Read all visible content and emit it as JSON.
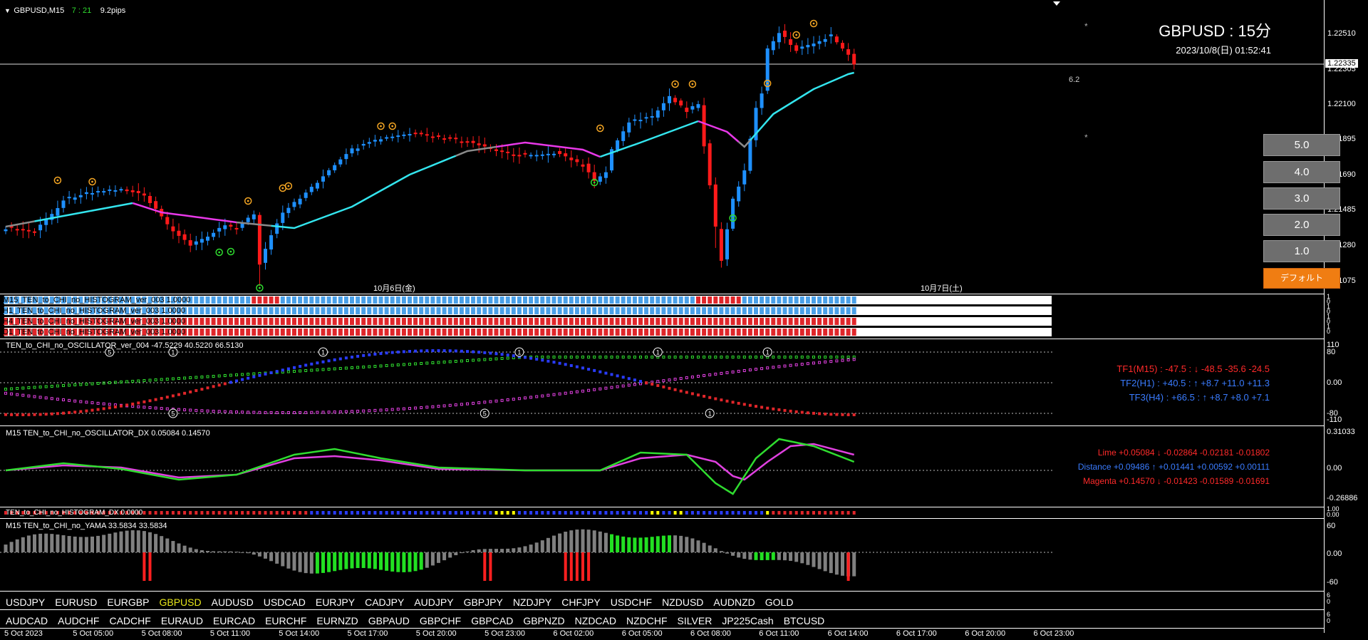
{
  "header": {
    "symbol_tf": "GBPUSD,M15",
    "timer": "7 : 21",
    "spread": "9.2pips",
    "big_title": "GBPUSD : 15分",
    "datetime": "2023/10/8(日) 01:52:41",
    "spread_value": "6.2",
    "star": "*"
  },
  "price_axis": {
    "ticks": [
      "1.22510",
      "1.22305",
      "1.22100",
      "1.21895",
      "1.21690",
      "1.21485",
      "1.21280",
      "1.21075"
    ],
    "current": "1.22335"
  },
  "day_labels": [
    "10月6日(金)",
    "10月7日(土)"
  ],
  "side_buttons": [
    "5.0",
    "4.0",
    "3.0",
    "2.0",
    "1.0",
    "デフォルト"
  ],
  "colors": {
    "bull": "#1e90ff",
    "bear": "#ff1a1a",
    "ma_cyan": "#33e5ee",
    "ma_magenta": "#e838e8",
    "ma_gray": "#8a8a8a",
    "hist_blue": "#4aa0e8",
    "hist_red": "#e0262a",
    "osc_green": "#2fdc2f",
    "osc_magenta": "#e040e0",
    "yama_gray": "#808080",
    "yama_green": "#22e022",
    "yama_red": "#ff2020",
    "active_symbol": "#e7e61a",
    "default_button": "#f07d12"
  },
  "histograms": [
    {
      "label": "M15_TEN_to_CHI_no_HISTOGRAM_ver_003 1.0000",
      "scale_top": "1",
      "scale_bot": "0"
    },
    {
      "label": "H1_TEN_to_CHI_no_HISTOGRAM_ver_003 1.0000",
      "scale_top": "1",
      "scale_bot": "0"
    },
    {
      "label": "H4_TEN_to_CHI_no_HISTOGRAM_ver_003 1.0000",
      "scale_top": "1",
      "scale_bot": "0"
    },
    {
      "label": "D1_TEN_to_CHI_no_HISTOGRAM_ver_003 1.0000",
      "scale_top": "1",
      "scale_bot": "0"
    }
  ],
  "oscillator": {
    "label": "TEN_to_CHI_no_OSCILLATOR_ver_004 -47.5229 40.5220 66.5130",
    "scale": [
      "110",
      "80",
      "0.00",
      "-80",
      "-110"
    ],
    "tf1": "TF1(M15) : -47.5 : ↓ -48.5 -35.6 -24.5",
    "tf2": "TF2(H1) : +40.5 : ↑ +8.7 +11.0 +11.3",
    "tf3": "TF3(H4) : +66.5 : ↑ +8.7 +8.0 +7.1",
    "markers": [
      "5",
      "5",
      "1",
      "1",
      "5",
      "1",
      "1",
      "1",
      "1"
    ]
  },
  "dx": {
    "label": "M15 TEN_to_CHI_no_OSCILLATOR_DX 0.05084 0.14570",
    "scale": [
      "0.31033",
      "0.00",
      "-0.26886"
    ],
    "lime": "Lime +0.05084 ↓ -0.02864 -0.02181 -0.01802",
    "distance": "Distance +0.09486 ↑ +0.01441 +0.00592 +0.00111",
    "magenta": "Magenta +0.14570 ↓ -0.01423 -0.01589 -0.01691"
  },
  "hist_dx": {
    "label": "TEN_to_CHI_no_HISTOGRAM_DX 0.0000",
    "scale_top": "1.00",
    "scale_bot": "0.00"
  },
  "yama": {
    "label": "M15 TEN_to_CHI_no_YAMA 33.5834 33.5834",
    "scale": [
      "60",
      "0.00",
      "-60"
    ]
  },
  "symbols_row1": [
    "USDJPY",
    "EURUSD",
    "EURGBP",
    "GBPUSD",
    "AUDUSD",
    "USDCAD",
    "EURJPY",
    "CADJPY",
    "AUDJPY",
    "GBPJPY",
    "NZDJPY",
    "CHFJPY",
    "USDCHF",
    "NZDUSD",
    "AUDNZD",
    "GOLD"
  ],
  "active_symbol": "GBPUSD",
  "symbols_row2": [
    "AUDCAD",
    "AUDCHF",
    "CADCHF",
    "EURAUD",
    "EURCAD",
    "EURCHF",
    "EURNZD",
    "GBPAUD",
    "GBPCHF",
    "GBPCAD",
    "GBPNZD",
    "NZDCAD",
    "NZDCHF",
    "SILVER",
    "JP225Cash",
    "BTCUSD"
  ],
  "row_scales": {
    "row1_top": "6",
    "row1_bot": "0",
    "row2_top": "6",
    "row2_bot": "0"
  },
  "time_axis": [
    "5 Oct 2023",
    "5 Oct 05:00",
    "5 Oct 08:00",
    "5 Oct 11:00",
    "5 Oct 14:00",
    "5 Oct 17:00",
    "5 Oct 20:00",
    "5 Oct 23:00",
    "6 Oct 02:00",
    "6 Oct 05:00",
    "6 Oct 08:00",
    "6 Oct 11:00",
    "6 Oct 14:00",
    "6 Oct 17:00",
    "6 Oct 20:00",
    "6 Oct 23:00"
  ]
}
